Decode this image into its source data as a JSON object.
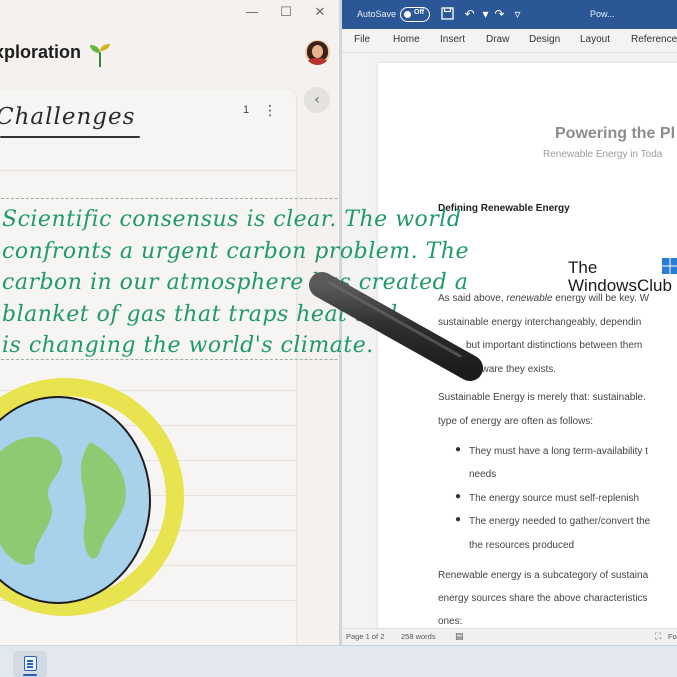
{
  "left_app": {
    "title": "xploration",
    "window_controls": {
      "minimize": "—",
      "maximize": "☐",
      "close": "✕"
    },
    "page_count": "1",
    "page_heading": "Challenges",
    "ink_text": [
      "Scientific consensus is clear. The world",
      "confronts a urgent carbon problem. The",
      "carbon in our atmosphere has created a",
      "blanket of gas that traps heat and",
      "is changing the world's climate."
    ],
    "colors": {
      "ink": "#1f9a69",
      "globe_ring": "#e5e23e",
      "globe_ocean": "#a8d1ec",
      "globe_land": "#8ccb72"
    }
  },
  "word": {
    "autosave_label": "AutoSave",
    "autosave_state": "Off",
    "doc_name": "Pow...",
    "tabs": [
      "File",
      "Home",
      "Insert",
      "Draw",
      "Design",
      "Layout",
      "References"
    ],
    "title": "Powering the Pl",
    "subtitle": "Renewable Energy in Toda",
    "section_heading": "Defining Renewable Energy",
    "paragraphs": {
      "p1_line1_pre": "As said above, ",
      "p1_line1_em": "renewable",
      "p1_line1_post": " energy will be key. W",
      "p1_line2": "sustainable energy interchangeably, dependin",
      "p1_line3": "but important distinctions between them",
      "p1_line4": "aware they exists.",
      "p2_line1": "Sustainable Energy is merely that: sustainable.",
      "p2_line2": "type of energy are often as follows:",
      "b1_line1": "They must have a long term-availability t",
      "b1_line2": "needs",
      "b2_line1": "The energy source must self-replenish",
      "b3_line1": "The energy needed to gather/convert the",
      "b3_line2": "the resources produced",
      "p3_line1": "Renewable energy is a subcategory of sustaina",
      "p3_line2": "energy sources share the above characteristics",
      "p3_line3": "ones:"
    },
    "status": {
      "page": "Page 1 of 2",
      "words": "258 words",
      "focus": "Fo"
    },
    "colors": {
      "ribbon": "#2b5797"
    }
  },
  "watermark": {
    "line1": "The",
    "line2": "WindowsClub"
  }
}
